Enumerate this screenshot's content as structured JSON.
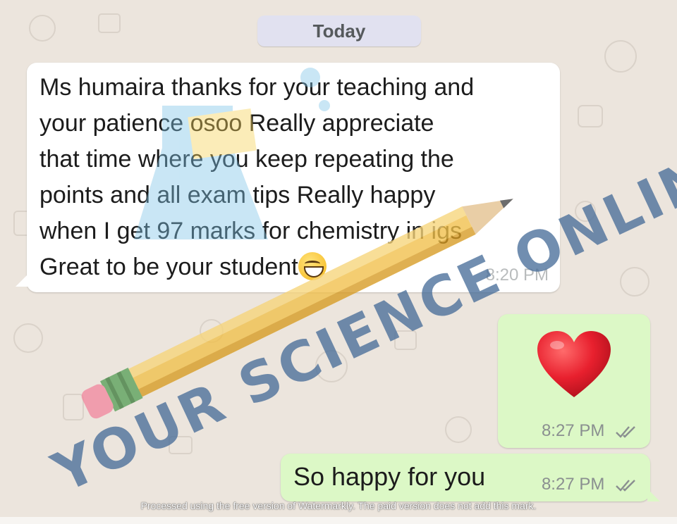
{
  "chat": {
    "date_label": "Today",
    "messages": [
      {
        "direction": "incoming",
        "text_lines": [
          "Ms humaira thanks for your teaching and",
          "your patience osoo Really appreciate",
          "that time where you keep repeating the",
          "points and all exam tips Really happy",
          "when I get 97 marks for chemistry in igs",
          "Great to be your student"
        ],
        "emoji": "grinning-face-emoji",
        "time": "8:20 PM"
      },
      {
        "direction": "outgoing",
        "emoji": "red-heart-emoji",
        "time": "8:27 PM",
        "status": "double-check-icon"
      },
      {
        "direction": "outgoing",
        "text": "So happy for you",
        "time": "8:27 PM",
        "status": "double-check-icon"
      }
    ]
  },
  "watermark": {
    "brand_text": "YOUR SCIENCE ONLINE",
    "notice": "Processed using the free version of Watermarkly. The paid version does not add this mark."
  },
  "colors": {
    "background": "#ece5dd",
    "incoming_bubble": "#ffffff",
    "outgoing_bubble": "#dcf8c6",
    "date_pill": "#e1e1f0",
    "watermark_blue": "#4a6f9a",
    "heart_red": "#e8202e"
  }
}
